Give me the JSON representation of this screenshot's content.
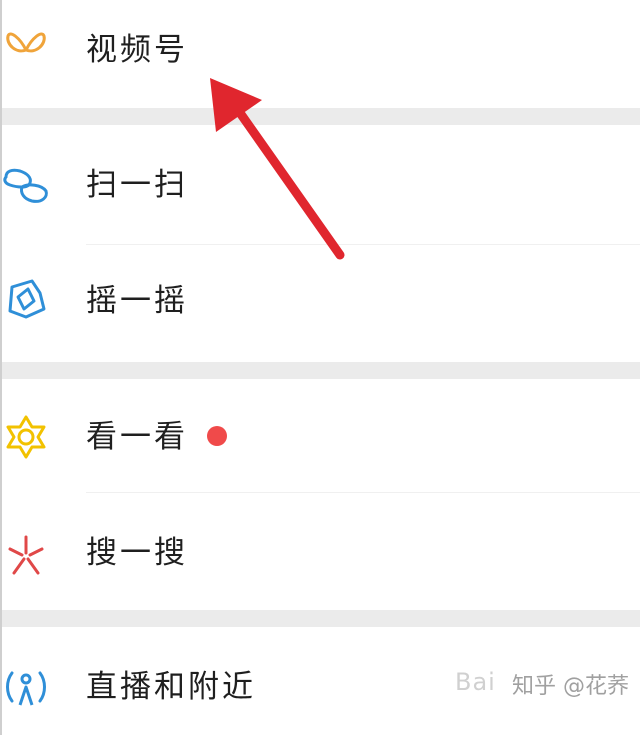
{
  "menu": {
    "channels": {
      "label": "视频号",
      "icon": "butterfly-icon",
      "color": "#F0A43A"
    },
    "scan": {
      "label": "扫一扫",
      "icon": "scan-icon",
      "color": "#2F8FD8"
    },
    "shake": {
      "label": "摇一摇",
      "icon": "shake-icon",
      "color": "#2F8FD8"
    },
    "top_stories": {
      "label": "看一看",
      "icon": "top-stories-icon",
      "color": "#F2C200",
      "badge": "red-dot"
    },
    "search": {
      "label": "搜一搜",
      "icon": "search-star-icon",
      "color": "#E04848"
    },
    "live_nearby": {
      "label": "直播和附近",
      "icon": "live-nearby-icon",
      "color": "#2F8FD8"
    }
  },
  "annotation": {
    "arrow_color": "#E0262E"
  },
  "watermarks": {
    "baidu": "Bai",
    "zhihu": "知乎 @花荞"
  }
}
